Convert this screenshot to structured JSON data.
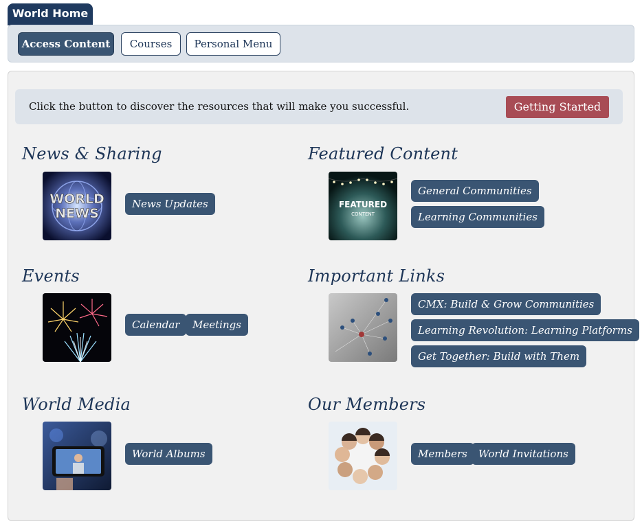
{
  "top_tab": {
    "label": "World Home"
  },
  "nav": {
    "access_content": "Access Content",
    "courses": "Courses",
    "personal_menu": "Personal Menu"
  },
  "banner": {
    "text": "Click the button to discover the resources that will make you successful.",
    "button": "Getting Started"
  },
  "sections": {
    "news": {
      "title": "News & Sharing",
      "image_label": "world-news",
      "buttons": [
        "News Updates"
      ]
    },
    "featured": {
      "title": "Featured Content",
      "image_text_1": "FEATURED",
      "image_text_2": "CONTENT",
      "buttons": [
        "General Communities",
        "Learning Communities"
      ]
    },
    "events": {
      "title": "Events",
      "buttons": [
        "Calendar",
        "Meetings"
      ]
    },
    "links": {
      "title": "Important Links",
      "buttons": [
        "CMX: Build & Grow Communities",
        "Learning Revolution: Learning Platforms",
        "Get Together: Build with Them"
      ]
    },
    "media": {
      "title": "World Media",
      "buttons": [
        "World Albums"
      ]
    },
    "members": {
      "title": "Our Members",
      "buttons": [
        "Members",
        "World Invitations"
      ]
    }
  },
  "colors": {
    "navy": "#1f3a5f",
    "button_blue": "#3a5573",
    "accent_red": "#a84c55",
    "nav_bg": "#dde3ea",
    "panel_bg": "#f1f1f1"
  }
}
